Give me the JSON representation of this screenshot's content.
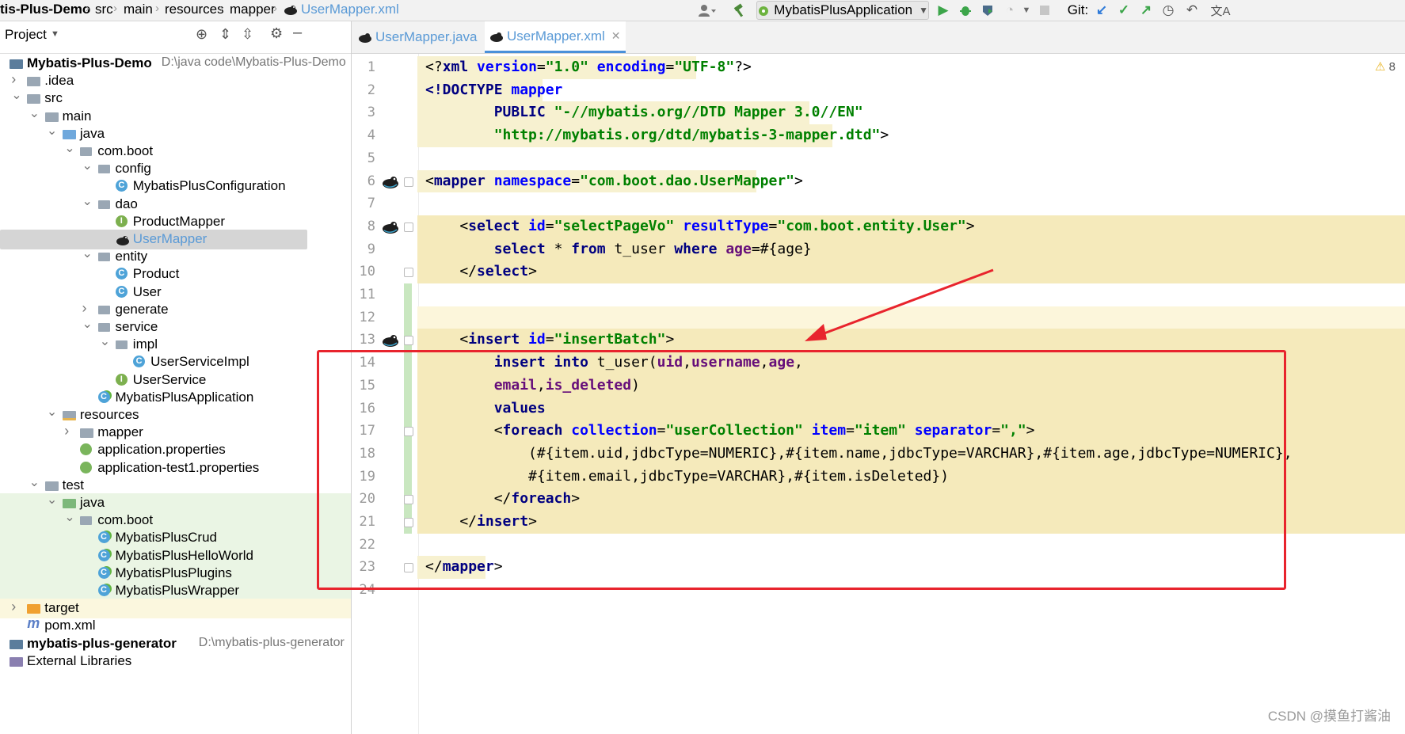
{
  "nav": {
    "project": "tis-Plus-Demo",
    "src": "src",
    "main": "main",
    "resources": "resources",
    "mapper": "mapper",
    "file": "UserMapper.xml",
    "run_config": "MybatisPlusApplication",
    "git_label": "Git:"
  },
  "project_panel": {
    "title": "Project",
    "tree": [
      {
        "label": "Mybatis-Plus-Demo",
        "path": "D:\\java code\\Mybatis-Plus-Demo",
        "bold": true,
        "icon": "module",
        "level": 0,
        "arrow": "",
        "highlight": ""
      },
      {
        "label": ".idea",
        "icon": "folder",
        "level": 1,
        "arrow": "right",
        "highlight": ""
      },
      {
        "label": "src",
        "icon": "folder",
        "level": 1,
        "arrow": "down",
        "highlight": ""
      },
      {
        "label": "main",
        "icon": "folder",
        "level": 2,
        "arrow": "down",
        "highlight": ""
      },
      {
        "label": "java",
        "icon": "folder-blue",
        "level": 3,
        "arrow": "down",
        "highlight": ""
      },
      {
        "label": "com.boot",
        "icon": "package",
        "level": 4,
        "arrow": "down",
        "highlight": ""
      },
      {
        "label": "config",
        "icon": "package",
        "level": 5,
        "arrow": "down",
        "highlight": ""
      },
      {
        "label": "MybatisPlusConfiguration",
        "icon": "class",
        "level": 6,
        "arrow": "",
        "highlight": ""
      },
      {
        "label": "dao",
        "icon": "package",
        "level": 5,
        "arrow": "down",
        "highlight": ""
      },
      {
        "label": "ProductMapper",
        "icon": "interface",
        "level": 6,
        "arrow": "",
        "highlight": ""
      },
      {
        "label": "UserMapper",
        "icon": "mybatis",
        "level": 6,
        "arrow": "",
        "highlight": "selected"
      },
      {
        "label": "entity",
        "icon": "package",
        "level": 5,
        "arrow": "down",
        "highlight": ""
      },
      {
        "label": "Product",
        "icon": "class",
        "level": 6,
        "arrow": "",
        "highlight": ""
      },
      {
        "label": "User",
        "icon": "class",
        "level": 6,
        "arrow": "",
        "highlight": ""
      },
      {
        "label": "generate",
        "icon": "package",
        "level": 5,
        "arrow": "right",
        "highlight": ""
      },
      {
        "label": "service",
        "icon": "package",
        "level": 5,
        "arrow": "down",
        "highlight": ""
      },
      {
        "label": "impl",
        "icon": "package",
        "level": 6,
        "arrow": "down",
        "highlight": ""
      },
      {
        "label": "UserServiceImpl",
        "icon": "class",
        "level": 7,
        "arrow": "",
        "highlight": ""
      },
      {
        "label": "UserService",
        "icon": "interface",
        "level": 6,
        "arrow": "",
        "highlight": ""
      },
      {
        "label": "MybatisPlusApplication",
        "icon": "app",
        "level": 5,
        "arrow": "",
        "highlight": ""
      },
      {
        "label": "resources",
        "icon": "folder-res",
        "level": 3,
        "arrow": "down",
        "highlight": ""
      },
      {
        "label": "mapper",
        "icon": "folder",
        "level": 4,
        "arrow": "right",
        "highlight": ""
      },
      {
        "label": "application.properties",
        "icon": "props",
        "level": 4,
        "arrow": "",
        "highlight": ""
      },
      {
        "label": "application-test1.properties",
        "icon": "props",
        "level": 4,
        "arrow": "",
        "highlight": ""
      },
      {
        "label": "test",
        "icon": "folder",
        "level": 2,
        "arrow": "down",
        "highlight": ""
      },
      {
        "label": "java",
        "icon": "folder-green",
        "level": 3,
        "arrow": "down",
        "highlight": "green"
      },
      {
        "label": "com.boot",
        "icon": "package",
        "level": 4,
        "arrow": "down",
        "highlight": "green"
      },
      {
        "label": "MybatisPlusCrud",
        "icon": "app",
        "level": 5,
        "arrow": "",
        "highlight": "green"
      },
      {
        "label": "MybatisPlusHelloWorld",
        "icon": "app",
        "level": 5,
        "arrow": "",
        "highlight": "green"
      },
      {
        "label": "MybatisPlusPlugins",
        "icon": "app",
        "level": 5,
        "arrow": "",
        "highlight": "green"
      },
      {
        "label": "MybatisPlusWrapper",
        "icon": "app",
        "level": 5,
        "arrow": "",
        "highlight": "green"
      },
      {
        "label": "target",
        "icon": "folder-orange",
        "level": 1,
        "arrow": "right",
        "highlight": "yellow"
      },
      {
        "label": "pom.xml",
        "icon": "maven",
        "level": 1,
        "arrow": "",
        "highlight": ""
      },
      {
        "label": "mybatis-plus-generator",
        "path": "D:\\mybatis-plus-generator",
        "bold": true,
        "icon": "module",
        "level": 0,
        "arrow": "right",
        "highlight": ""
      },
      {
        "label": "External Libraries",
        "icon": "lib",
        "level": 0,
        "arrow": "right",
        "highlight": ""
      }
    ]
  },
  "editor": {
    "tabs": [
      {
        "label": "UserMapper.java",
        "active": false
      },
      {
        "label": "UserMapper.xml",
        "active": true
      }
    ],
    "warning_count": "8",
    "line_numbers": [
      "1",
      "2",
      "3",
      "4",
      "5",
      "6",
      "7",
      "8",
      "9",
      "10",
      "11",
      "12",
      "13",
      "14",
      "15",
      "16",
      "17",
      "18",
      "19",
      "20",
      "21",
      "22",
      "23",
      "24"
    ],
    "lines": [
      [
        [
          "pl",
          "<?"
        ],
        [
          "tg",
          "xml "
        ],
        [
          "at",
          "version"
        ],
        [
          "pl",
          "="
        ],
        [
          "av",
          "\"1.0\" "
        ],
        [
          "at",
          "encoding"
        ],
        [
          "pl",
          "="
        ],
        [
          "av",
          "\"UTF-8\""
        ],
        [
          "pl",
          "?>"
        ]
      ],
      [
        [
          "tg",
          "<!DOCTYPE "
        ],
        [
          "at",
          "mapper"
        ]
      ],
      [
        [
          "pl",
          "        "
        ],
        [
          "tg",
          "PUBLIC "
        ],
        [
          "av",
          "\"-//mybatis.org//DTD Mapper 3.0//EN\""
        ]
      ],
      [
        [
          "pl",
          "        "
        ],
        [
          "av",
          "\"http://mybatis.org/dtd/mybatis-3-mapper.dtd\""
        ],
        [
          "pl",
          ">"
        ]
      ],
      [],
      [
        [
          "pl",
          "<"
        ],
        [
          "tg",
          "mapper "
        ],
        [
          "at",
          "namespace"
        ],
        [
          "pl",
          "="
        ],
        [
          "av",
          "\"com.boot.dao.UserMapper\""
        ],
        [
          "pl",
          ">"
        ]
      ],
      [],
      [
        [
          "pl",
          "    <"
        ],
        [
          "tg",
          "select "
        ],
        [
          "at",
          "id"
        ],
        [
          "pl",
          "="
        ],
        [
          "av",
          "\"selectPageVo\" "
        ],
        [
          "at",
          "resultType"
        ],
        [
          "pl",
          "="
        ],
        [
          "av",
          "\"com.boot.entity.User\""
        ],
        [
          "pl",
          ">"
        ]
      ],
      [
        [
          "pl",
          "        "
        ],
        [
          "kw",
          "select "
        ],
        [
          "pl",
          "* "
        ],
        [
          "kw",
          "from "
        ],
        [
          "pl",
          "t_user "
        ],
        [
          "kw",
          "where "
        ],
        [
          "fld",
          "age"
        ],
        [
          "pl",
          "=#{age}"
        ]
      ],
      [
        [
          "pl",
          "    </"
        ],
        [
          "tg",
          "select"
        ],
        [
          "pl",
          ">"
        ]
      ],
      [],
      [],
      [
        [
          "pl",
          "    <"
        ],
        [
          "tg",
          "insert "
        ],
        [
          "at",
          "id"
        ],
        [
          "pl",
          "="
        ],
        [
          "av",
          "\"insertBatch\""
        ],
        [
          "pl",
          ">"
        ]
      ],
      [
        [
          "pl",
          "        "
        ],
        [
          "kw",
          "insert into "
        ],
        [
          "pl",
          "t_user("
        ],
        [
          "fld",
          "uid"
        ],
        [
          "pl",
          ","
        ],
        [
          "fld",
          "username"
        ],
        [
          "pl",
          ","
        ],
        [
          "fld",
          "age"
        ],
        [
          "pl",
          ","
        ]
      ],
      [
        [
          "pl",
          "        "
        ],
        [
          "fld",
          "email"
        ],
        [
          "pl",
          ","
        ],
        [
          "fld",
          "is_deleted"
        ],
        [
          "pl",
          ")"
        ]
      ],
      [
        [
          "pl",
          "        "
        ],
        [
          "kw",
          "values"
        ]
      ],
      [
        [
          "pl",
          "        <"
        ],
        [
          "tg",
          "foreach "
        ],
        [
          "at",
          "collection"
        ],
        [
          "pl",
          "="
        ],
        [
          "av",
          "\"userCollection\" "
        ],
        [
          "at",
          "item"
        ],
        [
          "pl",
          "="
        ],
        [
          "av",
          "\"item\" "
        ],
        [
          "at",
          "separator"
        ],
        [
          "pl",
          "="
        ],
        [
          "av",
          "\",\""
        ],
        [
          "pl",
          ">"
        ]
      ],
      [
        [
          "pl",
          "            (#{item.uid,jdbcType=NUMERIC},#{item.name,jdbcType=VARCHAR},#{item.age,jdbcType=NUMERIC},"
        ]
      ],
      [
        [
          "pl",
          "            #{item.email,jdbcType=VARCHAR},#{item.isDeleted})"
        ]
      ],
      [
        [
          "pl",
          "        </"
        ],
        [
          "tg",
          "foreach"
        ],
        [
          "pl",
          ">"
        ]
      ],
      [
        [
          "pl",
          "    </"
        ],
        [
          "tg",
          "insert"
        ],
        [
          "pl",
          ">"
        ]
      ],
      [],
      [
        [
          "pl",
          "</"
        ],
        [
          "tg",
          "mapper"
        ],
        [
          "pl",
          ">"
        ]
      ],
      []
    ]
  },
  "watermark": "CSDN @摸鱼打酱油",
  "colors": {
    "accent": "#4a90d9",
    "annotation_red": "#e8242d",
    "highlight_yellow": "#f5eabb"
  }
}
